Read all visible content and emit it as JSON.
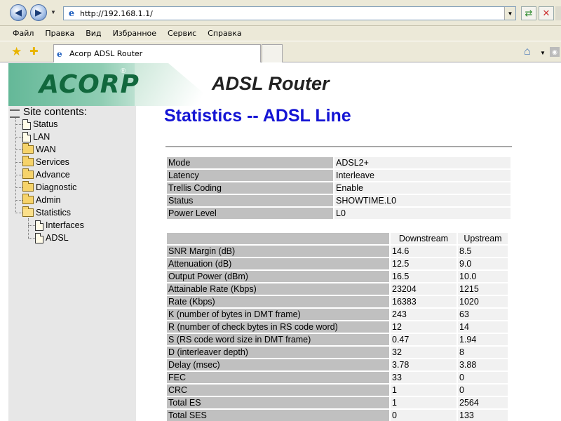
{
  "browser": {
    "url": "http://192.168.1.1/",
    "menu": [
      "Файл",
      "Правка",
      "Вид",
      "Избранное",
      "Сервис",
      "Справка"
    ],
    "tab_title": "Acorp ADSL Router"
  },
  "header": {
    "logo_text": "ACORP",
    "product": "ADSL Router"
  },
  "sidebar": {
    "title": "Site contents:",
    "items": [
      {
        "label": "Status",
        "type": "doc"
      },
      {
        "label": "LAN",
        "type": "doc"
      },
      {
        "label": "WAN",
        "type": "folder"
      },
      {
        "label": "Services",
        "type": "folder"
      },
      {
        "label": "Advance",
        "type": "folder"
      },
      {
        "label": "Diagnostic",
        "type": "folder"
      },
      {
        "label": "Admin",
        "type": "folder"
      },
      {
        "label": "Statistics",
        "type": "folder-open"
      }
    ],
    "subitems": [
      {
        "label": "Interfaces",
        "type": "doc"
      },
      {
        "label": "ADSL",
        "type": "doc"
      }
    ]
  },
  "main": {
    "title": "Statistics -- ADSL Line",
    "mode_rows": [
      {
        "label": "Mode",
        "value": "ADSL2+"
      },
      {
        "label": "Latency",
        "value": "Interleave"
      },
      {
        "label": "Trellis Coding",
        "value": "Enable"
      },
      {
        "label": "Status",
        "value": "SHOWTIME.L0"
      },
      {
        "label": "Power Level",
        "value": "L0"
      }
    ],
    "stats_headers": [
      "Downstream",
      "Upstream"
    ],
    "stats_rows": [
      {
        "label": "SNR Margin (dB)",
        "down": "14.6",
        "up": "8.5"
      },
      {
        "label": "Attenuation (dB)",
        "down": "12.5",
        "up": "9.0"
      },
      {
        "label": "Output Power (dBm)",
        "down": "16.5",
        "up": "10.0"
      },
      {
        "label": "Attainable Rate (Kbps)",
        "down": "23204",
        "up": "1215"
      },
      {
        "label": "Rate (Kbps)",
        "down": "16383",
        "up": "1020"
      },
      {
        "label": "K (number of bytes in DMT frame)",
        "down": "243",
        "up": "63"
      },
      {
        "label": "R (number of check bytes in RS code word)",
        "down": "12",
        "up": "14"
      },
      {
        "label": "S (RS code word size in DMT frame)",
        "down": "0.47",
        "up": "1.94"
      },
      {
        "label": "D (interleaver depth)",
        "down": "32",
        "up": "8"
      },
      {
        "label": "Delay (msec)",
        "down": "3.78",
        "up": "3.88"
      },
      {
        "label": "FEC",
        "down": "33",
        "up": "0"
      },
      {
        "label": "CRC",
        "down": "1",
        "up": "0"
      },
      {
        "label": "Total ES",
        "down": "1",
        "up": "2564"
      },
      {
        "label": "Total SES",
        "down": "0",
        "up": "133"
      }
    ]
  }
}
